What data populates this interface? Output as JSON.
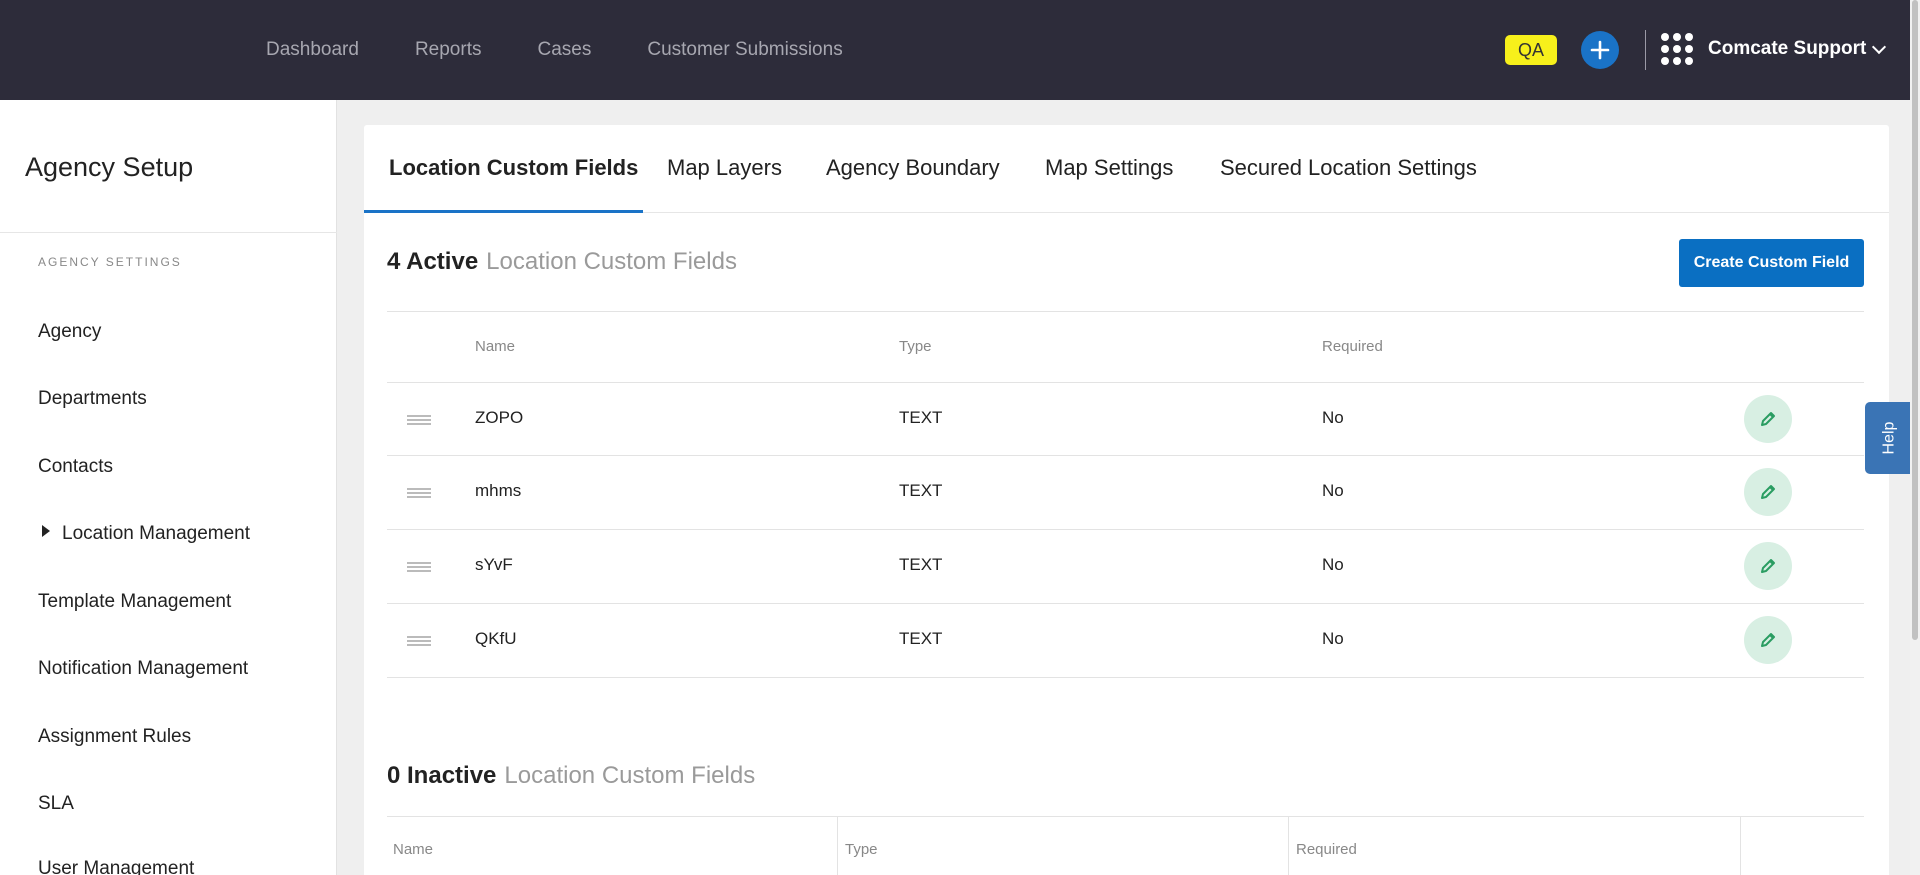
{
  "topbar": {
    "nav": [
      "Dashboard",
      "Reports",
      "Cases",
      "Customer Submissions"
    ],
    "env_badge": "QA",
    "org_name": "Comcate Support",
    "icons": {
      "add": "plus-icon",
      "apps": "apps-grid-icon",
      "menu": "chevron-down-icon"
    },
    "colors": {
      "bar": "#2d2c3a",
      "badge": "#f7f01b",
      "accent": "#1a73c7"
    }
  },
  "sidebar": {
    "title": "Agency Setup",
    "section_label": "AGENCY SETTINGS",
    "items": [
      "Agency",
      "Departments",
      "Contacts",
      "Location Management",
      "Template Management",
      "Notification Management",
      "Assignment Rules",
      "SLA",
      "User Management"
    ]
  },
  "tabs": [
    "Location Custom Fields",
    "Map Layers",
    "Agency Boundary",
    "Map Settings",
    "Secured Location Settings"
  ],
  "active_section": {
    "count": "4 Active",
    "label": "Location Custom Fields",
    "create_button": "Create Custom Field",
    "columns": [
      "Name",
      "Type",
      "Required"
    ],
    "rows": [
      {
        "name": "ZOPO",
        "type": "TEXT",
        "required": "No"
      },
      {
        "name": "mhms",
        "type": "TEXT",
        "required": "No"
      },
      {
        "name": "sYvF",
        "type": "TEXT",
        "required": "No"
      },
      {
        "name": "QKfU",
        "type": "TEXT",
        "required": "No"
      }
    ]
  },
  "inactive_section": {
    "count": "0 Inactive",
    "label": "Location Custom Fields",
    "columns": [
      "Name",
      "Type",
      "Required"
    ]
  },
  "help_label": "Help"
}
